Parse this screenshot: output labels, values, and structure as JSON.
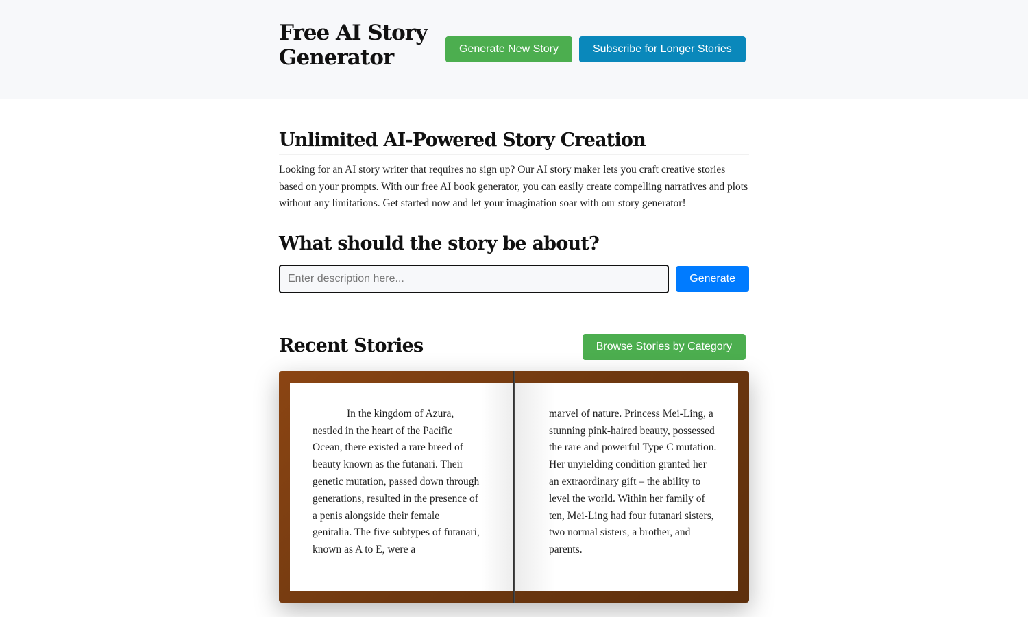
{
  "header": {
    "title": "Free AI Story Generator",
    "buttons": {
      "generate_new": "Generate New Story",
      "subscribe": "Subscribe for Longer Stories"
    }
  },
  "intro": {
    "heading": "Unlimited AI-Powered Story Creation",
    "paragraph": "Looking for an AI story writer that requires no sign up? Our AI story maker lets you craft creative stories based on your prompts. With our free AI book generator, you can easily create compelling narratives and plots without any limitations. Get started now and let your imagination soar with our story generator!"
  },
  "prompt": {
    "heading": "What should the story be about?",
    "input_placeholder": "Enter description here...",
    "input_value": "",
    "generate_label": "Generate"
  },
  "recent": {
    "heading": "Recent Stories",
    "browse_label": "Browse Stories by Category",
    "book": {
      "left_page": "In the kingdom of Azura, nestled in the heart of the Pacific Ocean, there existed a rare breed of beauty known as the futanari. Their genetic mutation, passed down through generations, resulted in the presence of a penis alongside their female genitalia. The five subtypes of futanari, known as A to E, were a",
      "right_page": "marvel of nature. Princess Mei-Ling, a stunning pink-haired beauty, possessed the rare and powerful Type C mutation. Her unyielding condition granted her an extraordinary gift – the ability to level the world. Within her family of ten, Mei-Ling had four futanari sisters, two normal sisters, a brother, and parents."
    }
  },
  "colors": {
    "green_button": "#4cae4f",
    "teal_button": "#0a88bb",
    "blue_button": "#007bff",
    "book_cover": "#8b4513",
    "header_bg": "#f7f8fa"
  }
}
